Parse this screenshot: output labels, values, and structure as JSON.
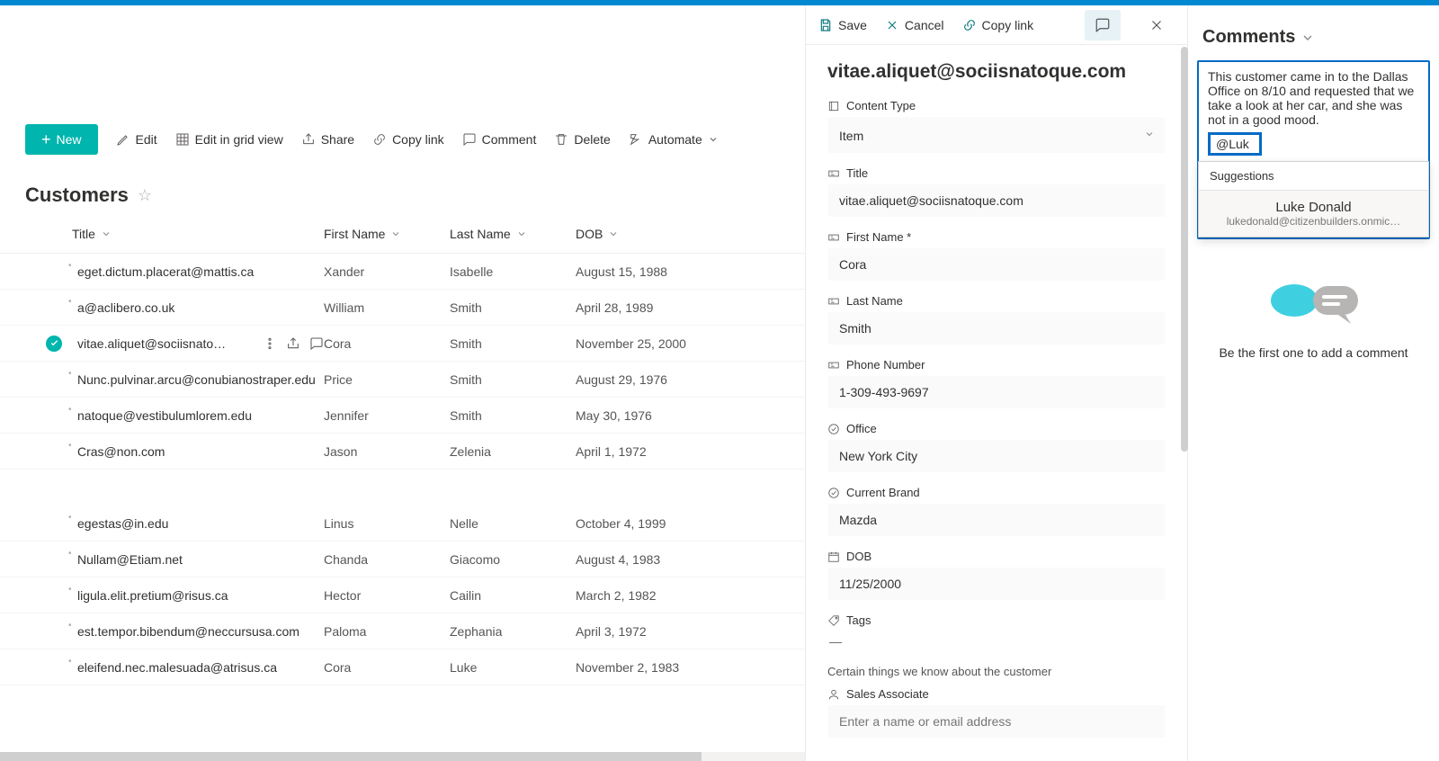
{
  "toolbar": {
    "save": "Save",
    "cancel": "Cancel",
    "copylink": "Copy link"
  },
  "commands": {
    "new": "New",
    "edit": "Edit",
    "editGrid": "Edit in grid view",
    "share": "Share",
    "copylink": "Copy link",
    "comment": "Comment",
    "delete": "Delete",
    "automate": "Automate"
  },
  "list": {
    "name": "Customers",
    "columns": {
      "title": "Title",
      "first": "First Name",
      "last": "Last Name",
      "dob": "DOB"
    }
  },
  "rows": [
    {
      "title": "eget.dictum.placerat@mattis.ca",
      "first": "Xander",
      "last": "Isabelle",
      "dob": "August 15, 1988",
      "selected": false
    },
    {
      "title": "a@aclibero.co.uk",
      "first": "William",
      "last": "Smith",
      "dob": "April 28, 1989",
      "selected": false
    },
    {
      "title": "vitae.aliquet@sociisnato…",
      "first": "Cora",
      "last": "Smith",
      "dob": "November 25, 2000",
      "selected": true
    },
    {
      "title": "Nunc.pulvinar.arcu@conubianostraper.edu",
      "first": "Price",
      "last": "Smith",
      "dob": "August 29, 1976",
      "selected": false
    },
    {
      "title": "natoque@vestibulumlorem.edu",
      "first": "Jennifer",
      "last": "Smith",
      "dob": "May 30, 1976",
      "selected": false
    },
    {
      "title": "Cras@non.com",
      "first": "Jason",
      "last": "Zelenia",
      "dob": "April 1, 1972",
      "selected": false
    },
    {
      "title": "egestas@in.edu",
      "first": "Linus",
      "last": "Nelle",
      "dob": "October 4, 1999",
      "selected": false
    },
    {
      "title": "Nullam@Etiam.net",
      "first": "Chanda",
      "last": "Giacomo",
      "dob": "August 4, 1983",
      "selected": false
    },
    {
      "title": "ligula.elit.pretium@risus.ca",
      "first": "Hector",
      "last": "Cailin",
      "dob": "March 2, 1982",
      "selected": false
    },
    {
      "title": "est.tempor.bibendum@neccursusa.com",
      "first": "Paloma",
      "last": "Zephania",
      "dob": "April 3, 1972",
      "selected": false
    },
    {
      "title": "eleifend.nec.malesuada@atrisus.ca",
      "first": "Cora",
      "last": "Luke",
      "dob": "November 2, 1983",
      "selected": false
    }
  ],
  "detail": {
    "heading": "vitae.aliquet@sociisnatoque.com",
    "contentTypeLabel": "Content Type",
    "contentTypeValue": "Item",
    "titleLabel": "Title",
    "titleValue": "vitae.aliquet@sociisnatoque.com",
    "firstLabel": "First Name *",
    "firstValue": "Cora",
    "lastLabel": "Last Name",
    "lastValue": "Smith",
    "phoneLabel": "Phone Number",
    "phoneValue": "1-309-493-9697",
    "officeLabel": "Office",
    "officeValue": "New York City",
    "brandLabel": "Current Brand",
    "brandValue": "Mazda",
    "dobLabel": "DOB",
    "dobValue": "11/25/2000",
    "tagsLabel": "Tags",
    "tagsValue": "—",
    "sectionNote": "Certain things we know about the customer",
    "salesAssocLabel": "Sales Associate",
    "salesAssocPlaceholder": "Enter a name or email address"
  },
  "comments": {
    "heading": "Comments",
    "draftText": "This customer came in to the Dallas Office on 8/10 and requested that we take a look at her car, and she was not in a good mood.",
    "mentionDraft": "@Luk",
    "suggestionsLabel": "Suggestions",
    "suggestion": {
      "name": "Luke Donald",
      "email": "lukedonald@citizenbuilders.onmic…"
    },
    "emptyText": "Be the first one to add a comment"
  }
}
